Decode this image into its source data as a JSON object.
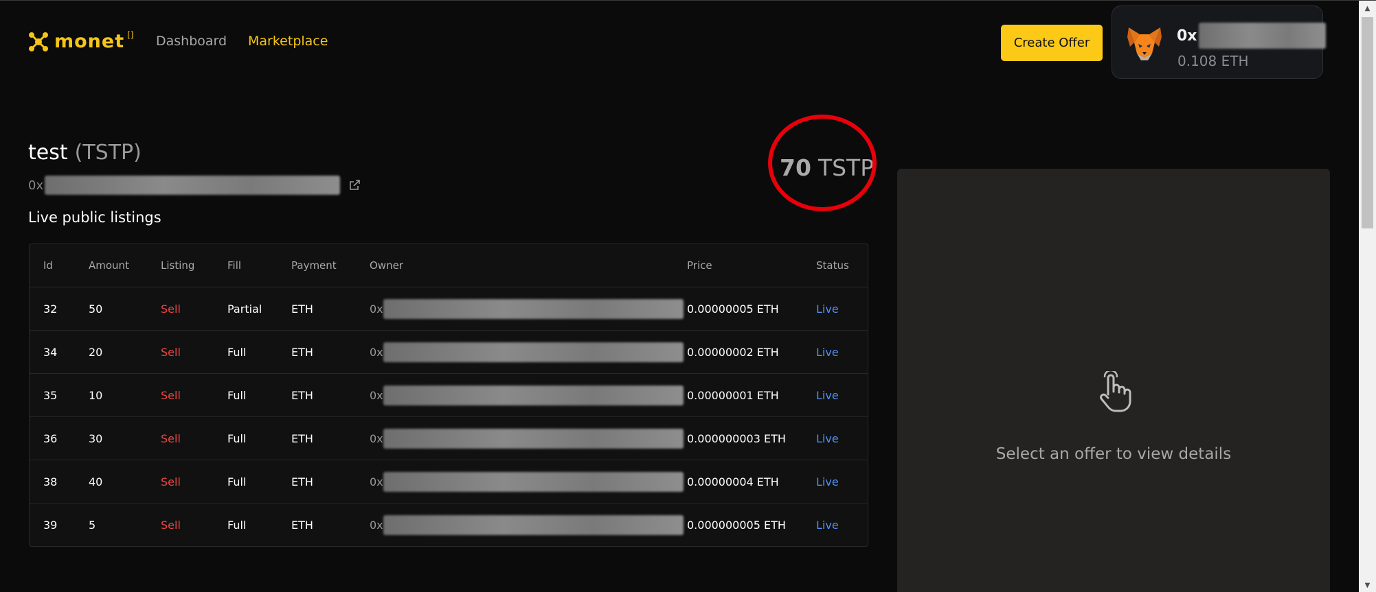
{
  "header": {
    "logo_text": "monet",
    "logo_sup": "[]",
    "nav": [
      {
        "label": "Dashboard",
        "active": false
      },
      {
        "label": "Marketplace",
        "active": true
      }
    ],
    "create_offer_label": "Create Offer",
    "wallet": {
      "address_prefix": "0x",
      "balance": "0.108 ETH",
      "icon": "metamask-fox-icon"
    }
  },
  "token": {
    "name": "test",
    "symbol": "(TSTP)",
    "contract_prefix": "0x",
    "balance_amount": "70",
    "balance_symbol": "TSTP"
  },
  "listings": {
    "title": "Live public listings",
    "columns": [
      "Id",
      "Amount",
      "Listing",
      "Fill",
      "Payment",
      "Owner",
      "Price",
      "Status"
    ],
    "rows": [
      {
        "id": "32",
        "amount": "50",
        "listing": "Sell",
        "fill": "Partial",
        "payment": "ETH",
        "owner": "0x",
        "price": "0.00000005 ETH",
        "status": "Live"
      },
      {
        "id": "34",
        "amount": "20",
        "listing": "Sell",
        "fill": "Full",
        "payment": "ETH",
        "owner": "0x",
        "price": "0.00000002 ETH",
        "status": "Live"
      },
      {
        "id": "35",
        "amount": "10",
        "listing": "Sell",
        "fill": "Full",
        "payment": "ETH",
        "owner": "0x",
        "price": "0.00000001 ETH",
        "status": "Live"
      },
      {
        "id": "36",
        "amount": "30",
        "listing": "Sell",
        "fill": "Full",
        "payment": "ETH",
        "owner": "0x",
        "price": "0.000000003 ETH",
        "status": "Live"
      },
      {
        "id": "38",
        "amount": "40",
        "listing": "Sell",
        "fill": "Full",
        "payment": "ETH",
        "owner": "0x",
        "price": "0.00000004 ETH",
        "status": "Live"
      },
      {
        "id": "39",
        "amount": "5",
        "listing": "Sell",
        "fill": "Full",
        "payment": "ETH",
        "owner": "0x",
        "price": "0.000000005 ETH",
        "status": "Live"
      }
    ]
  },
  "details_panel": {
    "hint": "Select an offer to view details",
    "icon": "pointer-hand-icon"
  },
  "colors": {
    "accent": "#fcc916",
    "sell": "#ef4444",
    "live": "#4f8ff7",
    "annotation_circle": "#e8000b"
  }
}
